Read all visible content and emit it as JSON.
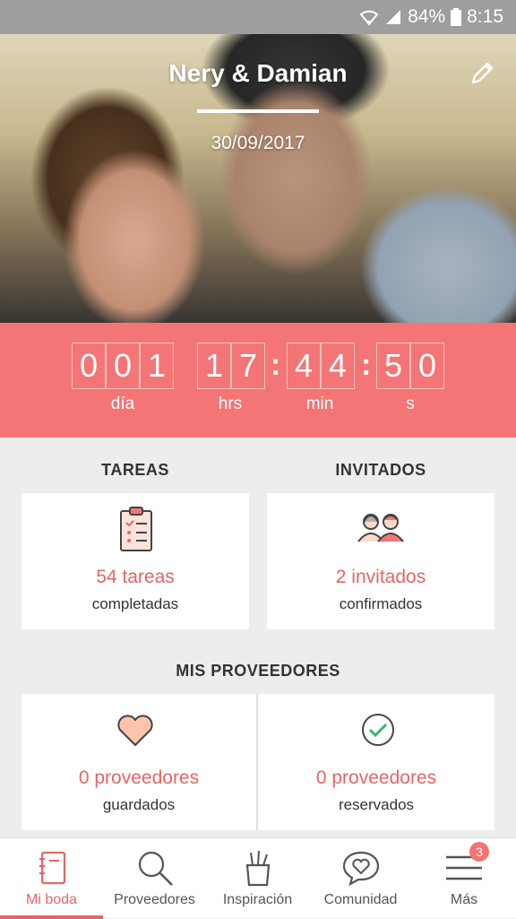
{
  "status_bar": {
    "battery": "84%",
    "time": "8:15"
  },
  "header": {
    "couple_name": "Nery & Damian",
    "date": "30/09/2017"
  },
  "countdown": {
    "days": [
      "0",
      "0",
      "1"
    ],
    "hours": [
      "1",
      "7"
    ],
    "minutes": [
      "4",
      "4"
    ],
    "seconds": [
      "5",
      "0"
    ],
    "labels": {
      "days": "día",
      "hours": "hrs",
      "minutes": "min",
      "seconds": "s"
    }
  },
  "tareas": {
    "title": "TAREAS",
    "value": "54 tareas",
    "sub": "completadas"
  },
  "invitados": {
    "title": "INVITADOS",
    "value": "2 invitados",
    "sub": "confirmados"
  },
  "proveedores": {
    "title": "MIS PROVEEDORES",
    "saved": {
      "value": "0 proveedores",
      "sub": "guardados"
    },
    "booked": {
      "value": "0 proveedores",
      "sub": "reservados"
    }
  },
  "nav": {
    "items": [
      {
        "label": "Mi boda",
        "icon": "notebook-icon"
      },
      {
        "label": "Proveedores",
        "icon": "search-icon"
      },
      {
        "label": "Inspiración",
        "icon": "pencil-cup-icon"
      },
      {
        "label": "Comunidad",
        "icon": "chat-heart-icon"
      },
      {
        "label": "Más",
        "icon": "menu-icon"
      }
    ],
    "badge": "3"
  },
  "colors": {
    "accent": "#f47575",
    "accent_text": "#e56565",
    "background": "#ededed"
  }
}
